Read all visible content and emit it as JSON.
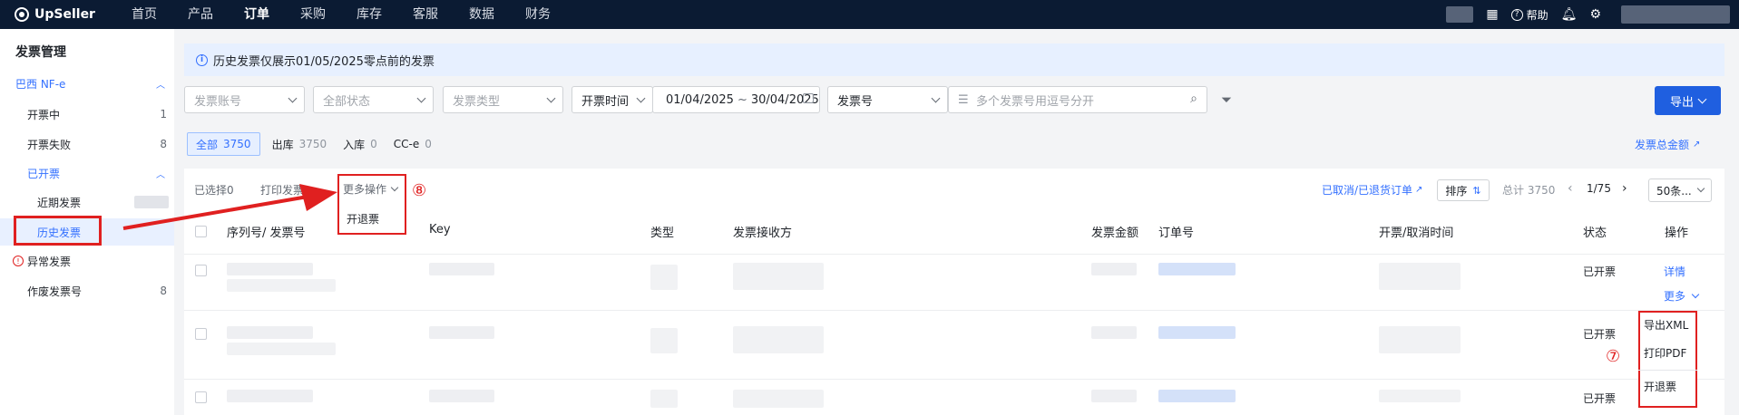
{
  "topbar": {
    "brand": "UpSeller",
    "nav": [
      "首页",
      "产品",
      "订单",
      "采购",
      "库存",
      "客服",
      "数据",
      "财务"
    ],
    "active_nav": "订单",
    "help": "帮助"
  },
  "sidebar": {
    "title": "发票管理",
    "group1": "巴西 NF-e",
    "items": [
      {
        "label": "开票中",
        "count": "1"
      },
      {
        "label": "开票失败",
        "count": "8"
      }
    ],
    "group2": "已开票",
    "sub_items": [
      {
        "label": "近期发票"
      },
      {
        "label": "历史发票"
      }
    ],
    "abnormal": "异常发票",
    "void": {
      "label": "作废发票号",
      "count": "8"
    }
  },
  "banner": "历史发票仅展示01/05/2025零点前的发票",
  "filters": {
    "account_ph": "发票账号",
    "status_ph": "全部状态",
    "type_ph": "发票类型",
    "time_field": "开票时间",
    "date_start": "01/04/2025",
    "date_sep": "~",
    "date_end": "30/04/2025",
    "number_field": "发票号",
    "number_ph": "多个发票号用逗号分开",
    "export": "导出"
  },
  "tabs": [
    {
      "label": "全部",
      "count": "3750"
    },
    {
      "label": "出库",
      "count": "3750"
    },
    {
      "label": "入库",
      "count": "0"
    },
    {
      "label": "CC-e",
      "count": "0"
    }
  ],
  "total_amount_link": "发票总金额",
  "toolbar": {
    "selected": "已选择0",
    "print": "打印发票",
    "more": "更多操作",
    "more_option": "开退票",
    "cancel_link": "已取消/已退货订单",
    "sort": "排序",
    "total": "总计 3750",
    "page": "1/75",
    "page_size": "50条..."
  },
  "table": {
    "headers": [
      "序列号/ 发票号",
      "Key",
      "类型",
      "发票接收方",
      "发票金额",
      "订单号",
      "开票/取消时间",
      "状态",
      "操作"
    ],
    "rows": [
      {
        "status": "已开票",
        "detail": "详情",
        "more": "更多"
      },
      {
        "status": "已开票"
      },
      {
        "status": "已开票"
      }
    ]
  },
  "row_menu": [
    "导出XML",
    "打印PDF",
    "开退票"
  ],
  "annotations": {
    "seven": "⑦",
    "eight": "⑧"
  }
}
